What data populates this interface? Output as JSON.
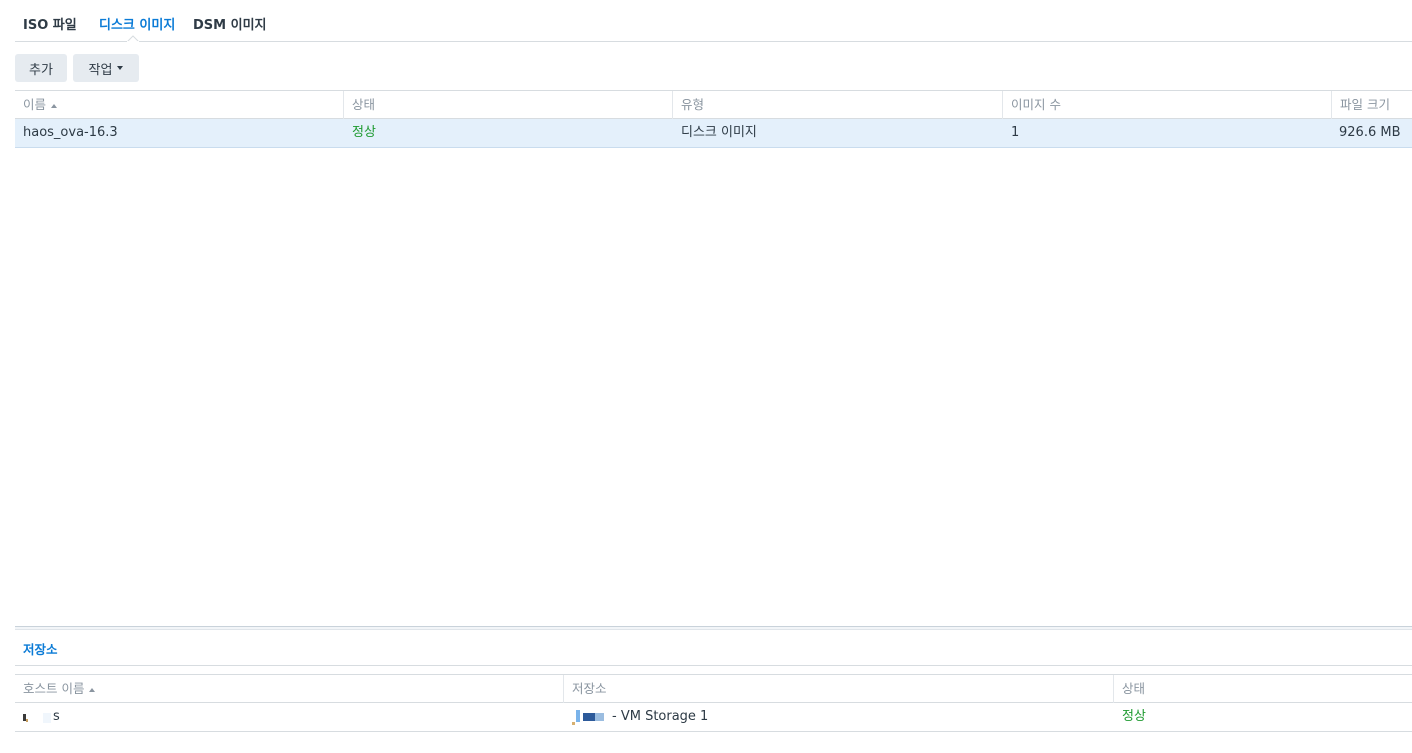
{
  "tabs": [
    {
      "label": "ISO 파일",
      "active": false
    },
    {
      "label": "디스크 이미지",
      "active": true
    },
    {
      "label": "DSM 이미지",
      "active": false
    }
  ],
  "toolbar": {
    "add_label": "추가",
    "action_label": "작업"
  },
  "image_table": {
    "columns": [
      "이름",
      "상태",
      "유형",
      "이미지 수",
      "파일 크기"
    ],
    "rows": [
      {
        "name": "haos_ova-16.3",
        "status": "정상",
        "type": "디스크 이미지",
        "image_count": "1",
        "file_size": "926.6 MB",
        "selected": true
      }
    ]
  },
  "bottom_panel": {
    "tab_label": "저장소",
    "columns": [
      "호스트 이름",
      "저장소",
      "상태"
    ],
    "rows": [
      {
        "host_suffix": "s",
        "storage_suffix": "- VM Storage 1",
        "status": "정상"
      }
    ]
  },
  "colors": {
    "accent": "#0b7bd6",
    "status_ok": "#1e9a30",
    "selected_row": "#e4f0fb",
    "button_bg": "#e6ebf0"
  }
}
